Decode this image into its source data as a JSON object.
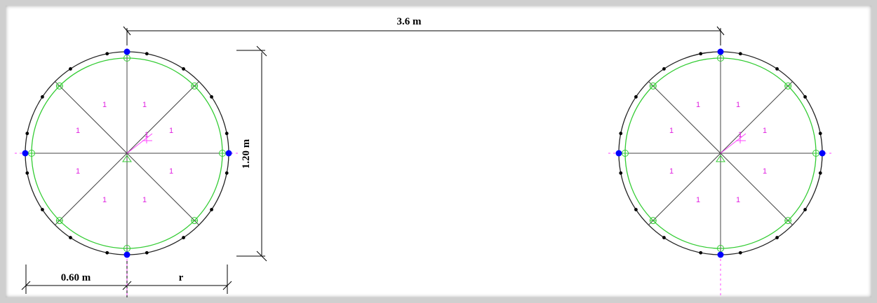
{
  "colors": {
    "outline": "#222222",
    "inner_ring": "#33cc33",
    "radial": "#444444",
    "axis": "#ff44ff",
    "zone_label": "#e020e0",
    "support_node": "#0000ff",
    "rebar_node": "#000000",
    "dimension": "#000000"
  },
  "dimensions": {
    "spacing_label": "3.6 m",
    "diameter_label": "1.20 m",
    "half_width_label": "0.60 m",
    "radius_label": "r"
  },
  "sections": [
    {
      "id": "left",
      "zone_labels": [
        "1",
        "1",
        "1",
        "1",
        "1",
        "1",
        "1",
        "1"
      ]
    },
    {
      "id": "right",
      "zone_labels": [
        "1",
        "1",
        "1",
        "1",
        "1",
        "1",
        "1",
        "1"
      ]
    }
  ],
  "icons": {
    "local_axis": "local-axis-icon",
    "support_node": "support-node-icon",
    "rebar_node": "rebar-dot-icon",
    "node_marker": "node-circle-marker-icon"
  }
}
